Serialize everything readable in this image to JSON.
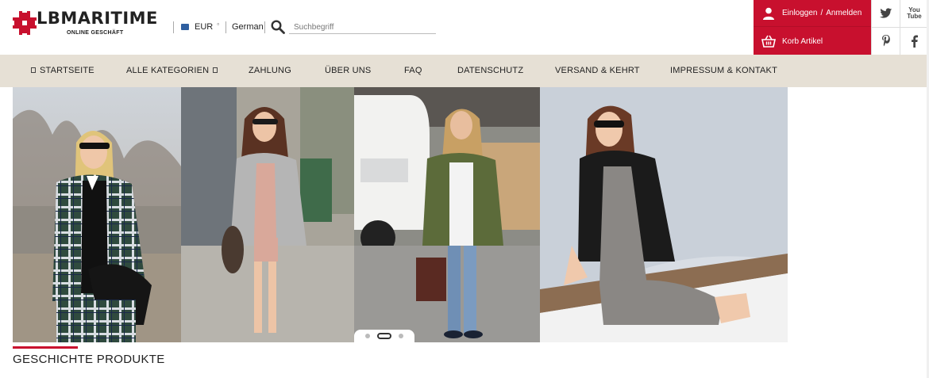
{
  "brand": {
    "name": "LBMARITIME",
    "tagline": "ONLINE GESCHÄFT",
    "accent_color": "#c8102e"
  },
  "header": {
    "currency": {
      "label": "EUR",
      "flag_icon": "eu-flag-icon"
    },
    "language": "German",
    "search": {
      "placeholder": "Suchbegriff",
      "value": ""
    }
  },
  "account": {
    "login_label": "Einloggen",
    "register_label": "Anmelden",
    "cart_label": "Korb Artikel"
  },
  "social": [
    "twitter-icon",
    "youtube-icon",
    "pinterest-icon",
    "facebook-icon"
  ],
  "social_youtube_text": {
    "line1": "You",
    "line2": "Tube"
  },
  "nav": {
    "items": [
      {
        "label": "STARTSEITE"
      },
      {
        "label": "ALLE KATEGORIEN"
      },
      {
        "label": "ZAHLUNG"
      },
      {
        "label": "ÜBER UNS"
      },
      {
        "label": "FAQ"
      },
      {
        "label": "DATENSCHUTZ"
      },
      {
        "label": "VERSAND & KEHRT"
      },
      {
        "label": "IMPRESSUM & KONTAKT"
      }
    ]
  },
  "carousel": {
    "slides": [
      "plaid-blazer-photo",
      "grey-coat-photo",
      "green-jacket-photo",
      "leather-jacket-photo"
    ],
    "dot_count": 3,
    "active_dot": 1
  },
  "section": {
    "title": "GESCHICHTE PRODUKTE"
  }
}
